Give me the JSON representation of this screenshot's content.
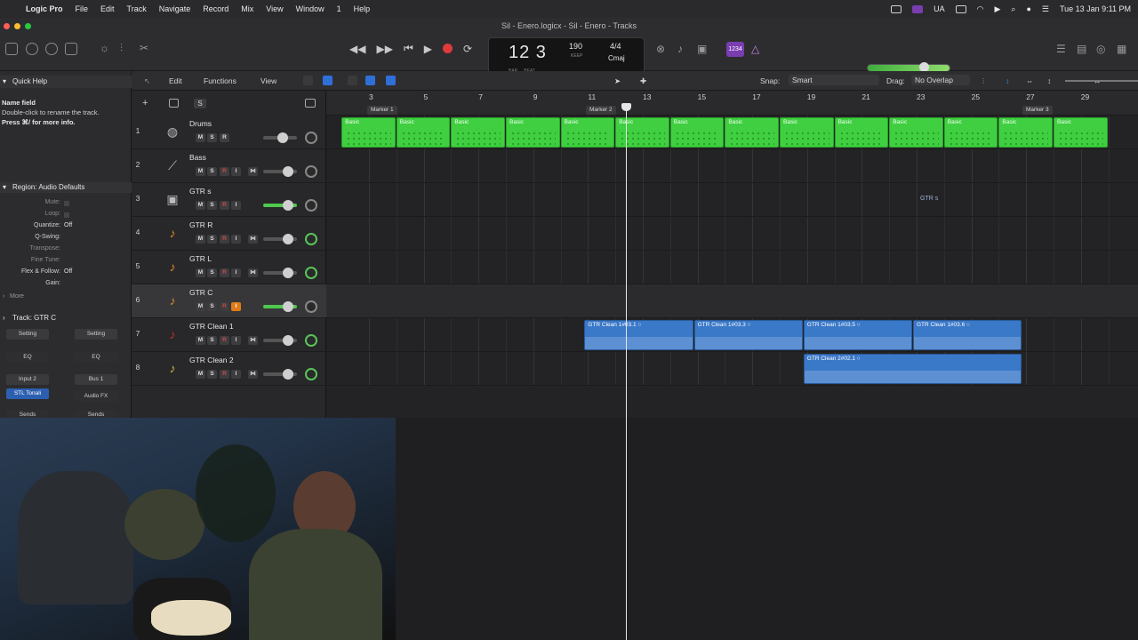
{
  "menubar": {
    "app": "Logic Pro",
    "items": [
      "File",
      "Edit",
      "Track",
      "Navigate",
      "Record",
      "Mix",
      "View",
      "Window",
      "1",
      "Help"
    ],
    "input_source": "UA",
    "datetime": "Tue 13 Jan  9:11 PM"
  },
  "window": {
    "title": "Sil - Enero.logicx - Sil - Enero - Tracks"
  },
  "lcd": {
    "position": "12  3",
    "bar_label": "BAR",
    "beat_label": "BEAT",
    "tempo": "190",
    "tempo_label": "KEEP",
    "time_sig": "4/4",
    "key": "Cmaj"
  },
  "count_in": "1234",
  "inspector": {
    "quick_help_title": "Quick Help",
    "help_heading": "Name field",
    "help_line1": "Double-click to rename the track.",
    "help_line2": "Press ⌘/ for more info.",
    "region_title": "Region: Audio Defaults",
    "region_rows": [
      {
        "label": "Mute:",
        "value": ""
      },
      {
        "label": "Loop:",
        "value": ""
      },
      {
        "label": "Quantize:",
        "value": "Off"
      },
      {
        "label": "Q-Swing:",
        "value": ""
      },
      {
        "label": "Transpose:",
        "value": ""
      },
      {
        "label": "Fine Tune:",
        "value": ""
      },
      {
        "label": "Flex & Follow:",
        "value": "Off"
      },
      {
        "label": "Gain:",
        "value": ""
      }
    ],
    "more_label": "More",
    "track_title": "Track: GTR C",
    "setting_left": "Setting",
    "setting_right": "Setting",
    "eq_left": "EQ",
    "eq_right": "EQ",
    "input_left": "Input 2",
    "input_right": "Bus 1",
    "plugin_left": "STL Tonali",
    "plugin_right": "Audio FX",
    "sends_left": "Sends",
    "sends_right": "Sends"
  },
  "toolbar": {
    "edit": "Edit",
    "functions": "Functions",
    "view": "View",
    "snap_label": "Snap:",
    "snap_value": "Smart",
    "drag_label": "Drag:",
    "drag_value": "No Overlap"
  },
  "tracklist_header": {
    "s_button": "S"
  },
  "tracks": [
    {
      "num": "1",
      "name": "Drums",
      "icon": "drum-kit-icon"
    },
    {
      "num": "2",
      "name": "Bass",
      "icon": "bass-guitar-icon"
    },
    {
      "num": "3",
      "name": "GTR s",
      "icon": "amp-icon"
    },
    {
      "num": "4",
      "name": "GTR R",
      "icon": "electric-guitar-icon"
    },
    {
      "num": "5",
      "name": "GTR L",
      "icon": "electric-guitar-icon"
    },
    {
      "num": "6",
      "name": "GTR C",
      "icon": "electric-guitar-icon"
    },
    {
      "num": "7",
      "name": "GTR Clean 1",
      "icon": "electric-guitar-icon"
    },
    {
      "num": "8",
      "name": "GTR Clean 2",
      "icon": "electric-guitar-icon"
    }
  ],
  "track_buttons": {
    "mute": "M",
    "solo": "S",
    "record": "R",
    "input": "I"
  },
  "ruler": {
    "bars": [
      "3",
      "5",
      "7",
      "9",
      "11",
      "13",
      "15",
      "17",
      "19",
      "21",
      "23",
      "25",
      "27",
      "29"
    ],
    "markers": [
      "Marker 1",
      "Marker 2",
      "Marker 3"
    ]
  },
  "regions": {
    "drum_label": "Basic",
    "gtrs_label": "GTR s",
    "clean1": [
      "GTR Clean 1#03.1",
      "GTR Clean 1#03.3",
      "GTR Clean 1#03.5",
      "GTR Clean 1#03.6"
    ],
    "clean2": [
      "GTR Clean 2#02.1"
    ]
  },
  "colors": {
    "drum_region": "#3fcf40",
    "audio_region": "#3a78c8",
    "record": "#e03a3a",
    "count_in": "#7a3db0",
    "input_monitor_on": "#e07a18"
  }
}
